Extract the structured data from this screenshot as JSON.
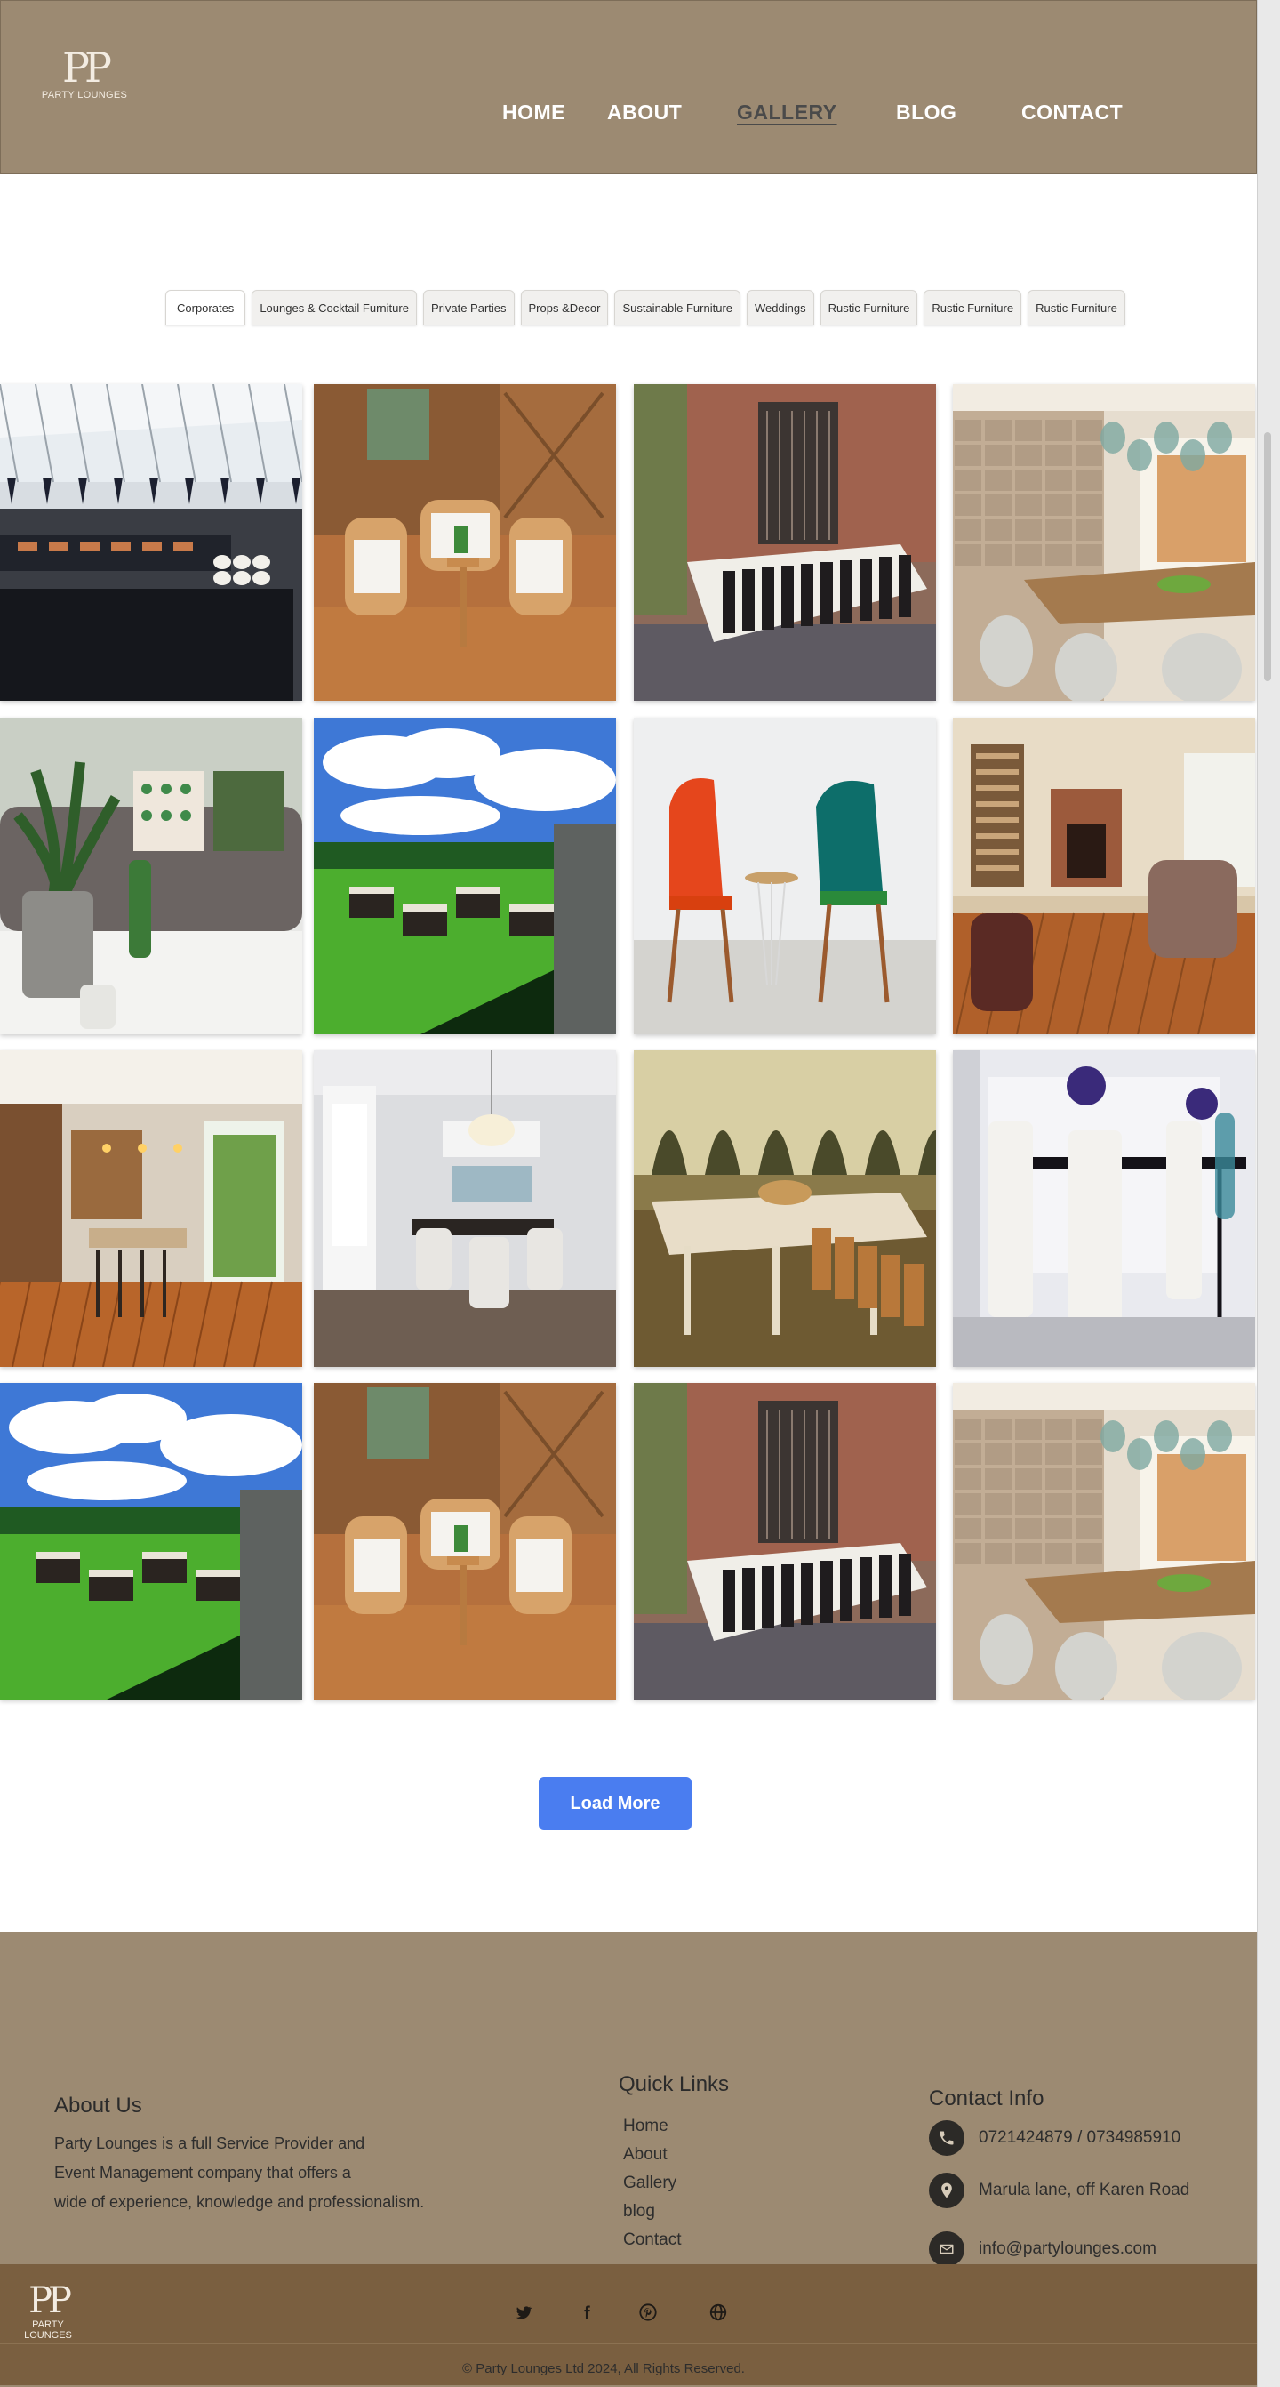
{
  "brand": {
    "monogram": "P",
    "name": "PARTY LOUNGES"
  },
  "nav": [
    {
      "label": "HOME"
    },
    {
      "label": "ABOUT"
    },
    {
      "label": "GALLERY"
    },
    {
      "label": "BLOG"
    },
    {
      "label": "CONTACT"
    }
  ],
  "active_nav": "GALLERY",
  "tabs": [
    {
      "label": "Corporates"
    },
    {
      "label": "Lounges & Cocktail Furniture"
    },
    {
      "label": "Private Parties"
    },
    {
      "label": "Props &Decor"
    },
    {
      "label": "Sustainable Furniture"
    },
    {
      "label": "Weddings"
    },
    {
      "label": "Rustic Furniture"
    },
    {
      "label": "Rustic Furniture"
    },
    {
      "label": "Rustic Furniture"
    }
  ],
  "active_tab": "Corporates",
  "gallery": [
    "tent-buffet",
    "lounge-chairs",
    "long-table-patio",
    "dining-kitchen",
    "sofa-plants",
    "garden-lawn",
    "colorful-chairs",
    "living-room",
    "kitchen-bar",
    "dining-room",
    "rustic-table",
    "white-dining",
    "garden-lawn",
    "lounge-chairs",
    "long-table-patio",
    "dining-kitchen"
  ],
  "load_more_label": "Load More",
  "footer": {
    "about_title": "About Us",
    "about_lines": [
      "Party Lounges is a full Service Provider and",
      "Event Management company that offers a",
      "wide of experience, knowledge and professionalism."
    ],
    "links_title": "Quick Links",
    "links": [
      "Home",
      "About",
      "Gallery",
      "blog",
      "Contact"
    ],
    "contact_title": "Contact Info",
    "phone": "0721424879 / 0734985910",
    "address": "Marula lane, off Karen Road",
    "email": "info@partylounges.com",
    "social_icons": [
      "twitter-icon",
      "facebook-icon",
      "pinterest-icon",
      "globe-icon"
    ],
    "copyright": "© Party Lounges Ltd 2024, All Rights Reserved."
  },
  "colors": {
    "header_bg": "#9c8a72",
    "footer_bar": "#7a5f40",
    "button_blue": "#4a7df0",
    "active_nav": "#4a4a4a"
  }
}
